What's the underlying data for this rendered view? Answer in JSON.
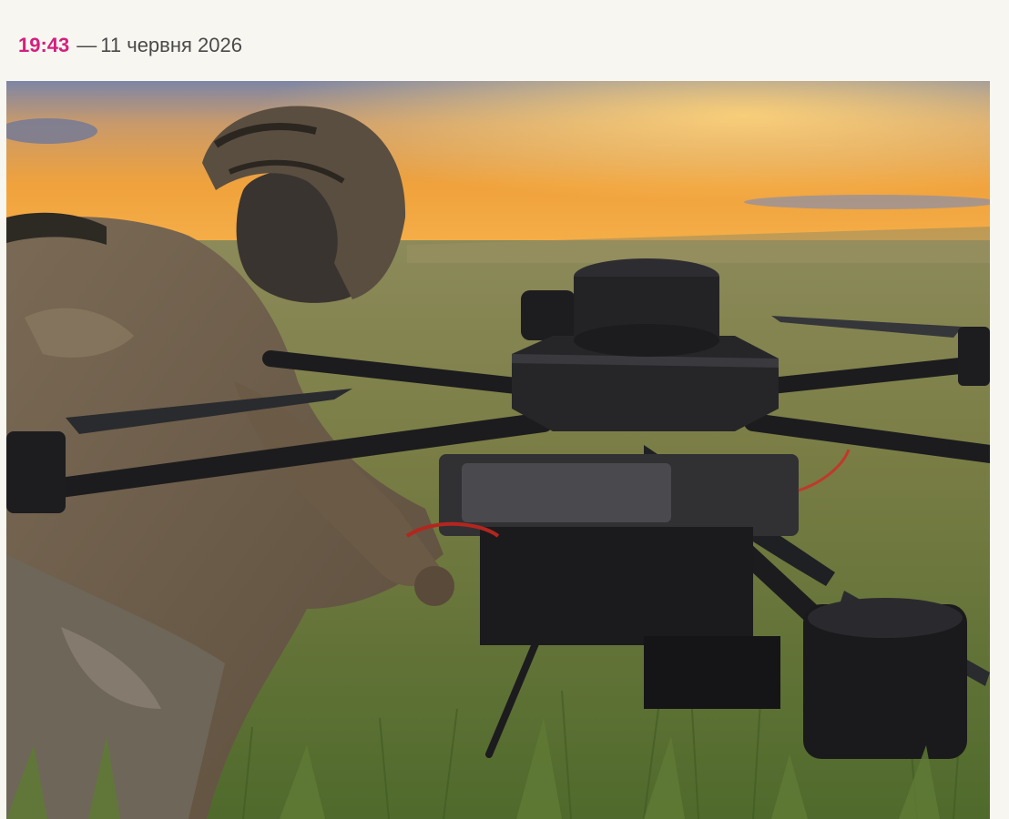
{
  "article": {
    "time": "19:43",
    "separator": "—",
    "date": "11 червня 2026"
  },
  "image": {
    "subject": "photo-soldier-with-heavy-drone"
  }
}
